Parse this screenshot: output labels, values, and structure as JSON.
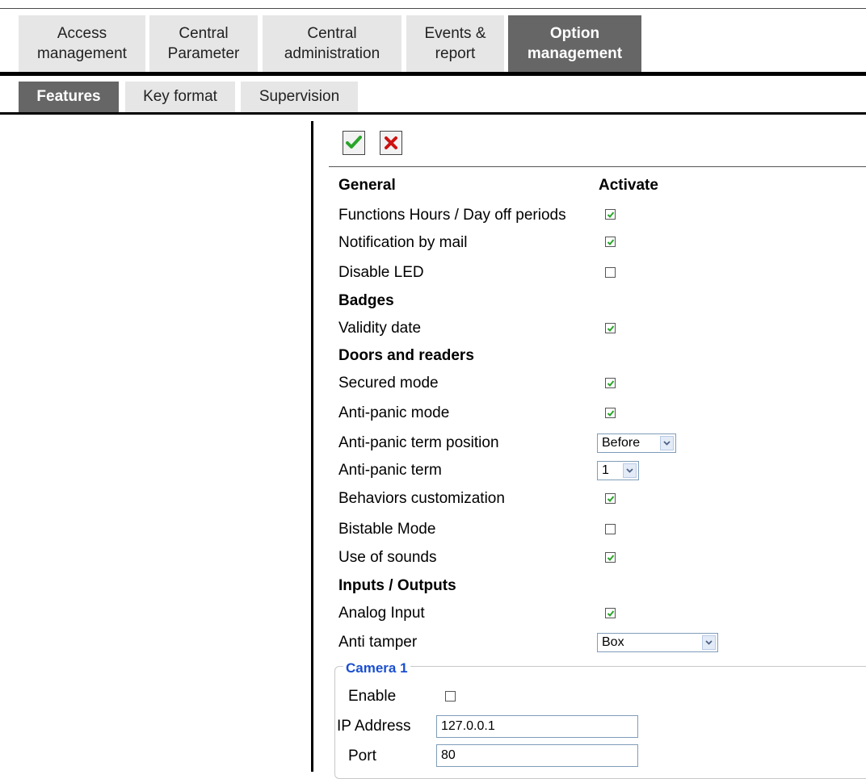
{
  "main_tabs": [
    {
      "line1": "Access",
      "line2": "management"
    },
    {
      "line1": "Central",
      "line2": "Parameter"
    },
    {
      "line1": "Central",
      "line2": "administration"
    },
    {
      "line1": "Events &",
      "line2": "report"
    },
    {
      "line1": "Option",
      "line2": "management"
    }
  ],
  "sub_tabs": [
    "Features",
    "Key format",
    "Supervision"
  ],
  "form": {
    "general_header": "General",
    "activate_header": "Activate",
    "functions_hours": "Functions Hours / Day off periods",
    "notification_mail": "Notification by mail",
    "disable_led": "Disable LED",
    "badges_header": "Badges",
    "validity_date": "Validity date",
    "doors_header": "Doors and readers",
    "secured_mode": "Secured mode",
    "anti_panic_mode": "Anti-panic mode",
    "anti_panic_term_position": "Anti-panic term position",
    "anti_panic_term_position_value": "Before",
    "anti_panic_term": "Anti-panic term",
    "anti_panic_term_value": "1",
    "behaviors_customization": "Behaviors customization",
    "bistable_mode": "Bistable Mode",
    "use_of_sounds": "Use of sounds",
    "io_header": "Inputs / Outputs",
    "analog_input": "Analog Input",
    "anti_tamper": "Anti tamper",
    "anti_tamper_value": "Box"
  },
  "checkboxes": {
    "functions_hours": true,
    "notification_mail": true,
    "disable_led": false,
    "validity_date": true,
    "secured_mode": true,
    "anti_panic_mode": true,
    "behaviors_customization": true,
    "bistable_mode": false,
    "use_of_sounds": true,
    "analog_input": true,
    "camera_enable": false
  },
  "camera": {
    "legend": "Camera 1",
    "enable_label": "Enable",
    "ip_label": "IP Address",
    "ip_value": "127.0.0.1",
    "port_label": "Port",
    "port_value": "80"
  },
  "colors": {
    "active_tab": "#666666",
    "inactive_tab": "#e6e6e6",
    "check_green": "#2aa52a",
    "legend_blue": "#1a4fcf",
    "cancel_red": "#cc1111"
  }
}
